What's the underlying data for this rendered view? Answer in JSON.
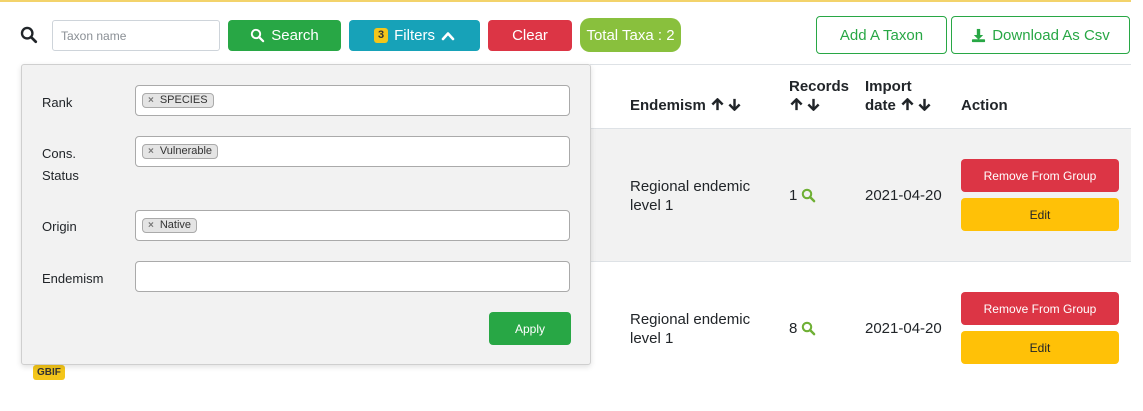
{
  "toolbar": {
    "search_placeholder": "Taxon name",
    "search_button": "Search",
    "filters_count": "3",
    "filters_button": "Filters",
    "clear_button": "Clear",
    "total_taxa": "Total Taxa : 2",
    "add_button": "Add A Taxon",
    "download_button": "Download As Csv"
  },
  "filters": {
    "rank_label": "Rank",
    "rank_chip": "SPECIES",
    "cons_status_label_line1": "Cons.",
    "cons_status_label_line2": "Status",
    "cons_status_chip": "Vulnerable",
    "origin_label": "Origin",
    "origin_chip": "Native",
    "endemism_label": "Endemism",
    "chip_remove": "×",
    "apply_button": "Apply"
  },
  "table": {
    "headers": {
      "endemism": "Endemism",
      "records": "Records",
      "import_line1": "Import",
      "import_line2": "date",
      "action": "Action"
    },
    "rows": [
      {
        "endemism_line1": "Regional endemic",
        "endemism_line2": "level 1",
        "records": "1",
        "import_date": "2021-04-20",
        "remove_label": "Remove From Group",
        "edit_label": "Edit"
      },
      {
        "endemism_line1": "Regional endemic",
        "endemism_line2": "level 1",
        "records": "8",
        "import_date": "2021-04-20",
        "remove_label": "Remove From Group",
        "edit_label": "Edit"
      }
    ],
    "source_badge": "GBIF"
  },
  "colors": {
    "success": "#28a745",
    "info": "#17a2b8",
    "danger": "#dc3545",
    "warning": "#ffc107",
    "lime": "#89c03d",
    "badge_yellow": "#f4c61a"
  }
}
